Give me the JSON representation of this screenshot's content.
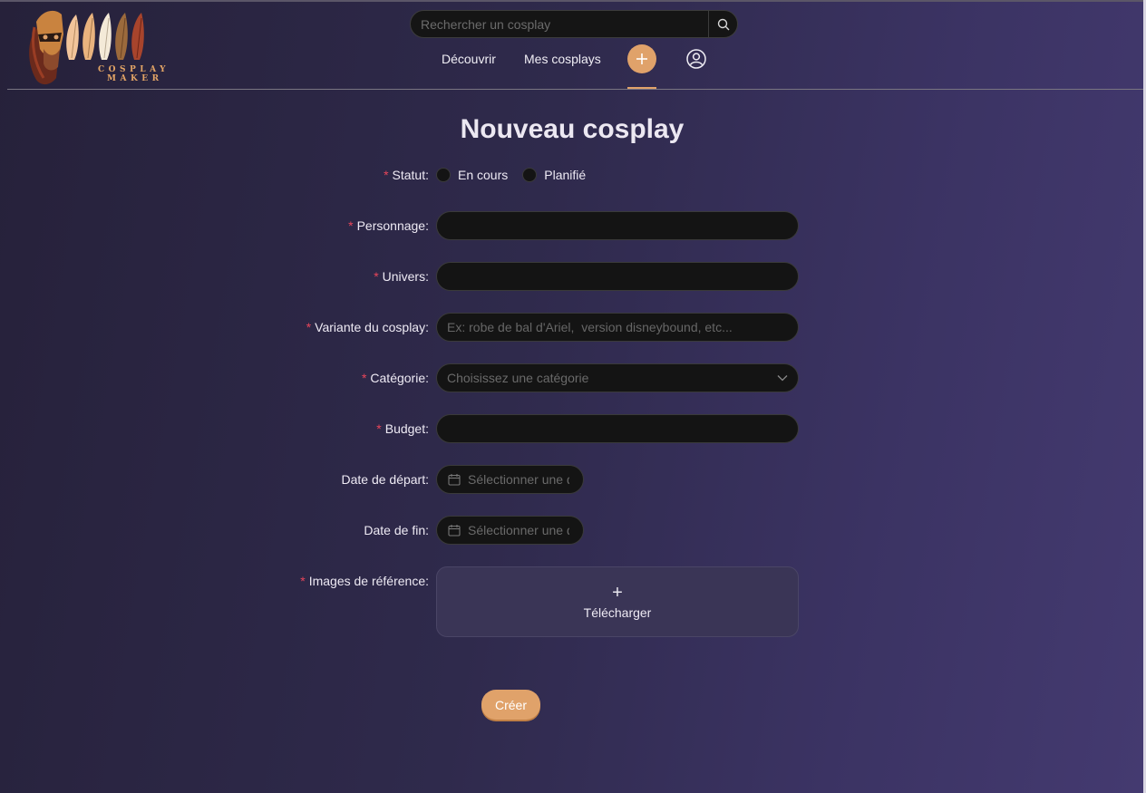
{
  "header": {
    "logo_text_line1": "COSPLAY",
    "logo_text_line2": "MAKER",
    "search_placeholder": "Rechercher un cosplay",
    "search_icon": "search-icon",
    "nav": {
      "discover": "Découvrir",
      "my_cosplays": "Mes cosplays",
      "add_icon": "plus-icon",
      "profile_icon": "user-circle-icon"
    }
  },
  "form": {
    "title": "Nouveau cosplay",
    "required_mark": "*",
    "status": {
      "label": "Statut",
      "options": [
        "En cours",
        "Planifié"
      ]
    },
    "character": {
      "label": "Personnage",
      "value": ""
    },
    "universe": {
      "label": "Univers",
      "value": ""
    },
    "variant": {
      "label": "Variante du cosplay",
      "placeholder": "Ex: robe de bal d'Ariel,  version disneybound, etc..."
    },
    "category": {
      "label": "Catégorie",
      "placeholder": "Choisissez une catégorie"
    },
    "budget": {
      "label": "Budget",
      "value": ""
    },
    "start_date": {
      "label": "Date de départ",
      "placeholder": "Sélectionner une date"
    },
    "end_date": {
      "label": "Date de fin",
      "placeholder": "Sélectionner une date"
    },
    "images": {
      "label": "Images de référence",
      "upload_label": "Télécharger",
      "upload_icon": "+"
    },
    "submit_label": "Créer"
  },
  "colors": {
    "accent": "#e0a26a",
    "required": "#e8465a",
    "field_bg": "#141414"
  }
}
